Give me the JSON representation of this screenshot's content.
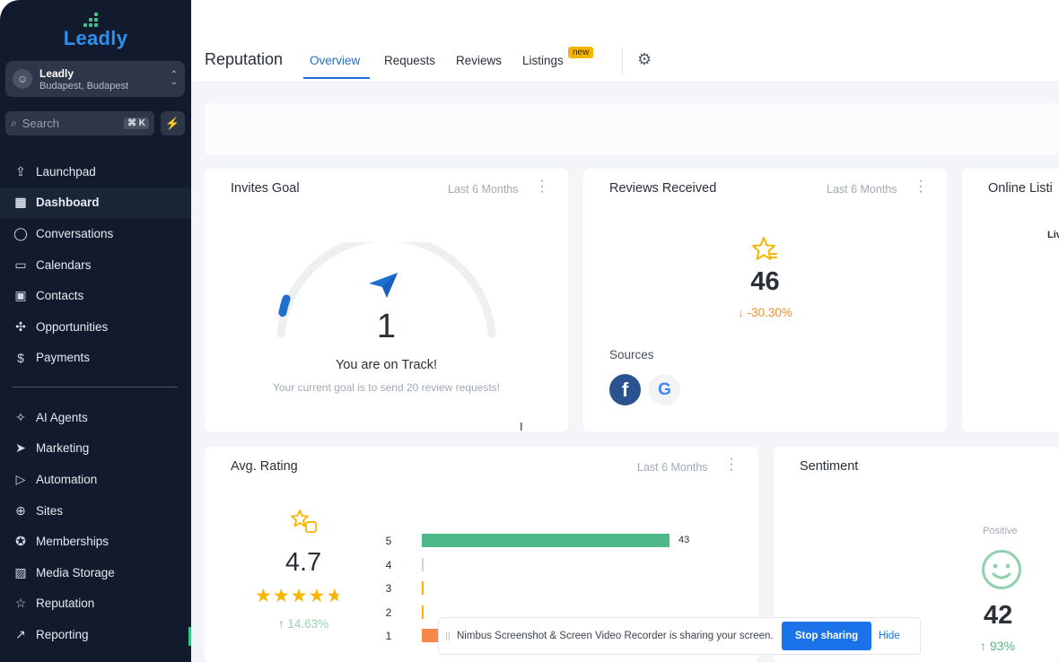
{
  "app": {
    "brand": "Leadly"
  },
  "account": {
    "name": "Leadly",
    "location": "Budapest, Budapest"
  },
  "search": {
    "placeholder": "Search",
    "shortcut": "⌘ K"
  },
  "nav": {
    "primary": [
      {
        "label": "Launchpad",
        "icon": "rocket-icon",
        "glyph": "⇪"
      },
      {
        "label": "Dashboard",
        "icon": "grid-icon",
        "glyph": "▦",
        "active": true
      },
      {
        "label": "Conversations",
        "icon": "chat-bubble-icon",
        "glyph": "◯"
      },
      {
        "label": "Calendars",
        "icon": "calendar-icon",
        "glyph": "▭"
      },
      {
        "label": "Contacts",
        "icon": "contacts-icon",
        "glyph": "▣"
      },
      {
        "label": "Opportunities",
        "icon": "network-icon",
        "glyph": "✣"
      },
      {
        "label": "Payments",
        "icon": "receipt-icon",
        "glyph": "$"
      }
    ],
    "secondary": [
      {
        "label": "AI Agents",
        "icon": "sparkles-icon",
        "glyph": "✧"
      },
      {
        "label": "Marketing",
        "icon": "send-icon",
        "glyph": "➤"
      },
      {
        "label": "Automation",
        "icon": "play-circle-icon",
        "glyph": "▷"
      },
      {
        "label": "Sites",
        "icon": "globe-icon",
        "glyph": "⊕"
      },
      {
        "label": "Memberships",
        "icon": "badge-icon",
        "glyph": "✪"
      },
      {
        "label": "Media Storage",
        "icon": "image-icon",
        "glyph": "▨"
      },
      {
        "label": "Reputation",
        "icon": "star-outline-icon",
        "glyph": "☆"
      },
      {
        "label": "Reporting",
        "icon": "trend-up-icon",
        "glyph": "↗"
      }
    ]
  },
  "header": {
    "title": "Reputation",
    "tabs": [
      "Overview",
      "Requests",
      "Reviews",
      "Listings"
    ],
    "new_badge": "new"
  },
  "cards": {
    "invites": {
      "title": "Invites Goal",
      "range": "Last 6 Months",
      "value": "1",
      "status": "You are on Track!",
      "note": "Your current goal is to send 20 review requests!",
      "gauge_fraction": 0.05
    },
    "reviews": {
      "title": "Reviews Received",
      "range": "Last 6 Months",
      "value": "46",
      "change": "-30.30%",
      "sources_label": "Sources",
      "sources": [
        "facebook",
        "google"
      ]
    },
    "listings": {
      "title": "Online Listi",
      "partial_label": "Liv"
    },
    "avg_rating": {
      "title": "Avg. Rating",
      "range": "Last 6 Months",
      "value": "4.7",
      "change": "14.63%",
      "stars": 4.7
    },
    "sentiment": {
      "title": "Sentiment",
      "positive_label": "Positive",
      "value": "42",
      "change": "93%"
    }
  },
  "chart_data": {
    "type": "bar",
    "orientation": "horizontal",
    "categories": [
      "5",
      "4",
      "3",
      "2",
      "1"
    ],
    "values": [
      43,
      0,
      0,
      0,
      2
    ],
    "data_labels": [
      "43",
      "",
      "",
      "",
      ""
    ],
    "colors": [
      "#4fb88b",
      "#cfd3d9",
      "#f7b500",
      "#f7b500",
      "#f5884a"
    ]
  },
  "share_banner": {
    "text": "Nimbus Screenshot & Screen Video Recorder is sharing your screen.",
    "stop_label": "Stop sharing",
    "hide_label": "Hide"
  }
}
